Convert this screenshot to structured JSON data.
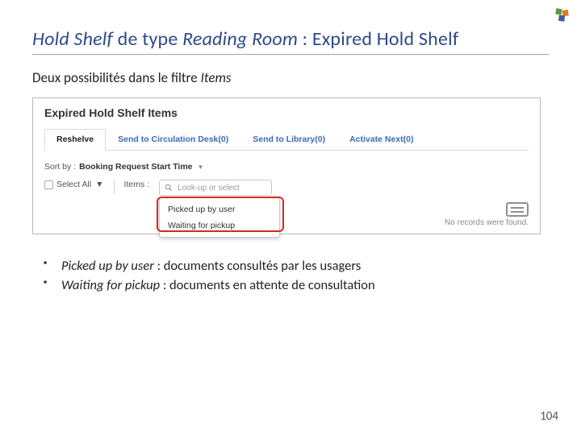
{
  "slide": {
    "title_part1": "Hold Shelf",
    "title_part2": " de type ",
    "title_part3": "Reading Room",
    "title_part4": " : Expired Hold Shelf",
    "subtitle_prefix": "Deux possibilités dans le filtre ",
    "subtitle_italic": "Items",
    "page_number": "104"
  },
  "screenshot": {
    "heading": "Expired Hold Shelf Items",
    "tabs": {
      "reshelve": "Reshelve",
      "send_circ": "Send to Circulation Desk(0)",
      "send_lib": "Send to Library(0)",
      "activate": "Activate Next(0)"
    },
    "sort_label": "Sort by :",
    "sort_value": "Booking Request Start Time",
    "select_all": "Select All",
    "items_label": "Items :",
    "lookup_placeholder": "Look-up or select",
    "dropdown": {
      "opt1": "Picked up by user",
      "opt2": "Waiting for pickup"
    },
    "empty_msg": "No records were found."
  },
  "bullets": {
    "b1_italic": "Picked up by user ",
    "b1_rest": ": documents consultés par les usagers",
    "b2_italic": "Waiting for pickup ",
    "b2_rest": ": documents en attente de consultation"
  }
}
